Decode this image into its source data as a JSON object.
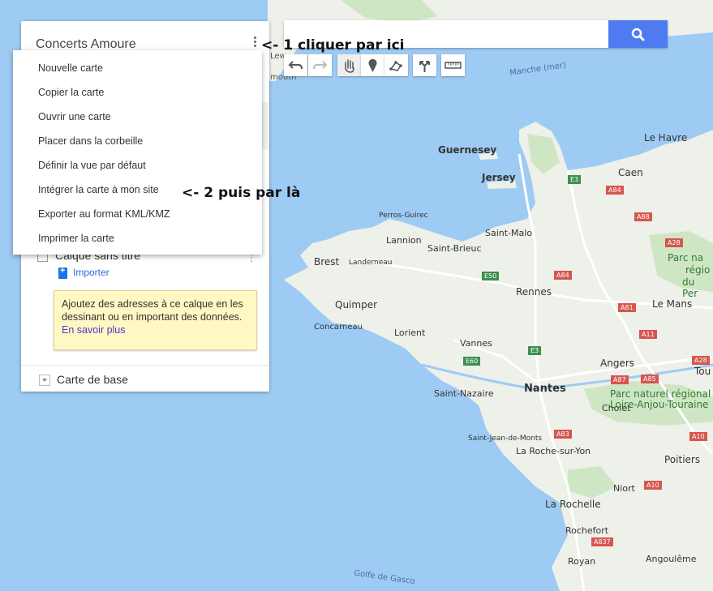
{
  "panel": {
    "title": "Concerts Amoure",
    "layer_name": "Calque sans titre",
    "import_label": "Importer",
    "tooltip_text": "Ajoutez des adresses à ce calque en les dessinant ou en important des données.",
    "tooltip_link": "En savoir plus",
    "base_map": "Carte de base"
  },
  "menu": {
    "items": [
      {
        "label": "Nouvelle carte"
      },
      {
        "label": "Copier la carte"
      },
      {
        "label": "Ouvrir une carte"
      },
      {
        "label": "Placer dans la corbeille"
      },
      {
        "label": "Définir la vue par défaut"
      },
      {
        "label": "Intégrer la carte à mon site"
      },
      {
        "label": "Exporter au format KML/KMZ"
      },
      {
        "label": "Imprimer la carte"
      }
    ]
  },
  "search": {
    "placeholder": "",
    "value": ""
  },
  "toolbar": {
    "icons": [
      "undo-icon",
      "redo-icon",
      "hand-icon",
      "marker-icon",
      "draw-line-icon",
      "directions-icon",
      "ruler-icon"
    ]
  },
  "annotations": {
    "step1": "<- 1 cliquer par ici",
    "step2": "<- 2 puis par là"
  },
  "map": {
    "labels": {
      "guernesey": "Guernesey",
      "jersey": "Jersey",
      "le_havre": "Le Havre",
      "caen": "Caen",
      "saint_malo": "Saint-Malo",
      "perros": "Perros-Guirec",
      "lannion": "Lannion",
      "saint_brieuc": "Saint-Brieuc",
      "brest": "Brest",
      "landerneau": "Landerneau",
      "rennes": "Rennes",
      "quimper": "Quimper",
      "concarneau": "Concarneau",
      "lorient": "Lorient",
      "vannes": "Vannes",
      "le_mans": "Le Mans",
      "angers": "Angers",
      "tours": "Tou",
      "nantes": "Nantes",
      "saint_nazaire": "Saint-Nazaire",
      "cholet": "Cholet",
      "saint_jean": "Saint-Jean-de-Monts",
      "la_roche": "La Roche-sur-Yon",
      "poitiers": "Poitiers",
      "niort": "Niort",
      "la_rochelle": "La Rochelle",
      "rochefort": "Rochefort",
      "royan": "Royan",
      "angouleme": "Angoulême",
      "manche": "Manche (mer)",
      "golfe": "Golfe de Gasco",
      "parc_normandie_1": "Parc na",
      "parc_normandie_2": "régio",
      "parc_normandie_3": "du Per",
      "parc_loire_1": "Parc naturel régional",
      "parc_loire_2": "Loire-Anjou-Touraine",
      "top_fragment": "Lew",
      "mouth_fragment": "mouth"
    },
    "roads": {
      "e3a": "E3",
      "a84a": "A84",
      "a88": "A88",
      "a28a": "A28",
      "e50": "E50",
      "a84b": "A84",
      "a81": "A81",
      "a11": "A11",
      "e3b": "E3",
      "e60": "E60",
      "a28b": "A28",
      "a87": "A87",
      "a85": "A85",
      "a83": "A83",
      "a10a": "A10",
      "a10b": "A10",
      "a837": "A837"
    }
  }
}
